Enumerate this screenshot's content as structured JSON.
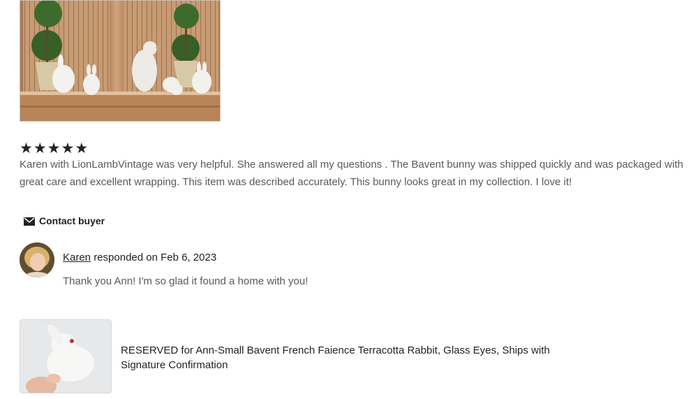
{
  "review": {
    "rating": 5,
    "stars": [
      "★",
      "★",
      "★",
      "★",
      "★"
    ],
    "text": "Karen with LionLambVintage was very helpful. She answered all my questions . The Bavent bunny was shipped quickly and was packaged with great care and excellent wrapping. This item was described accurately. This bunny looks great in my collection. I love it!"
  },
  "contact": {
    "label": "Contact buyer",
    "icon": "envelope-icon"
  },
  "response": {
    "name": "Karen",
    "date_text": " responded on Feb 6, 2023",
    "text": "Thank you Ann! I'm so glad it found a home with you!"
  },
  "listing": {
    "title": "RESERVED for Ann-Small Bavent French Faience Terracotta Rabbit, Glass Eyes, Ships with Signature Confirmation"
  }
}
